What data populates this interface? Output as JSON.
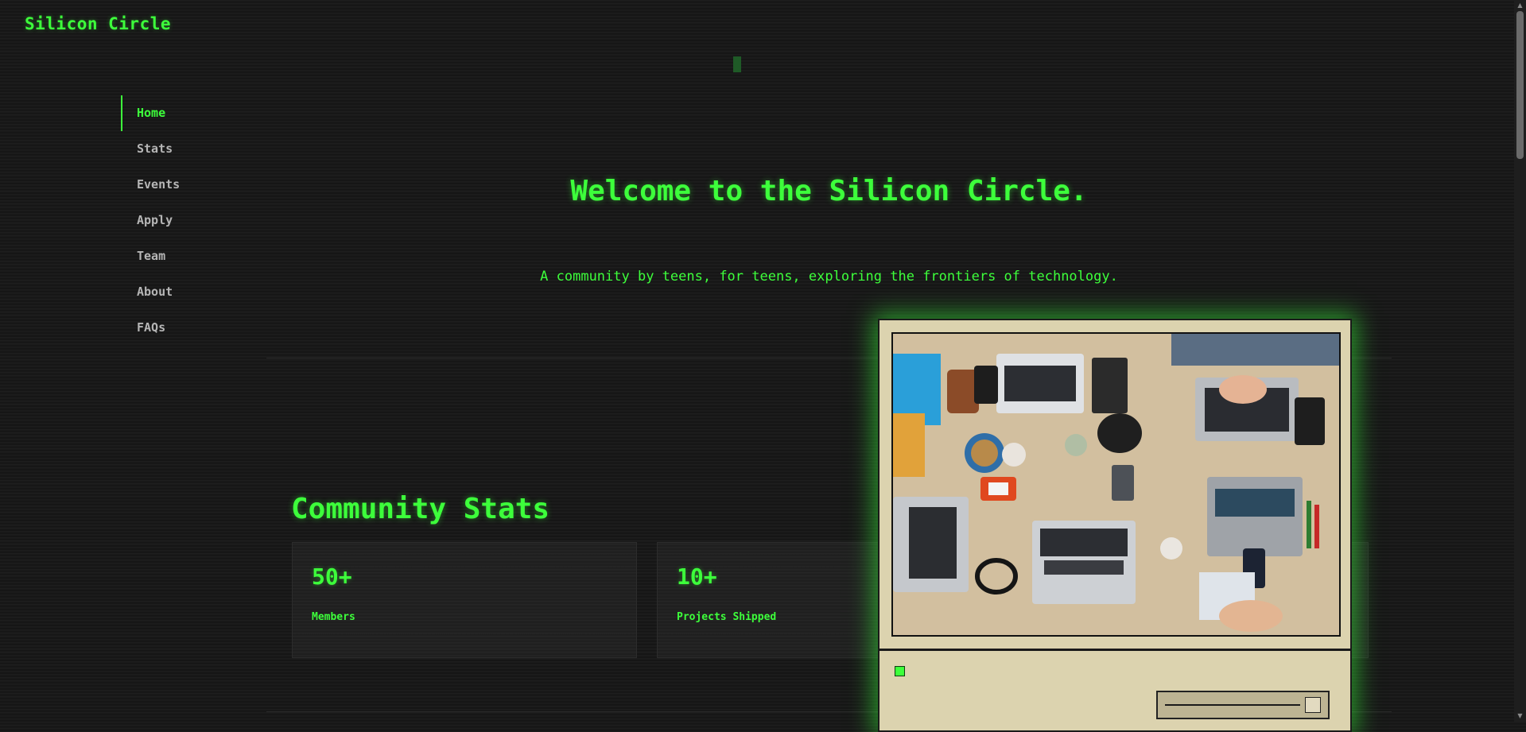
{
  "brand": "Silicon Circle",
  "nav": [
    {
      "label": "Home",
      "active": true
    },
    {
      "label": "Stats"
    },
    {
      "label": "Events"
    },
    {
      "label": "Apply"
    },
    {
      "label": "Team"
    },
    {
      "label": "About"
    },
    {
      "label": "FAQs"
    }
  ],
  "hero": {
    "title": "Welcome to the Silicon Circle.",
    "subtitle": "A community by teens, for teens, exploring the frontiers of technology."
  },
  "stats": {
    "title": "Community Stats",
    "items": [
      {
        "value": "50+",
        "label": "Members"
      },
      {
        "value": "10+",
        "label": "Projects Shipped"
      }
    ]
  },
  "colors": {
    "accent": "#3dff3b",
    "background": "#161616",
    "retro_beige": "#dcd3af"
  },
  "icons": {
    "power_led": "power-led-icon",
    "scroll_up": "scroll-up-arrow-icon",
    "scroll_down": "scroll-down-arrow-icon"
  }
}
